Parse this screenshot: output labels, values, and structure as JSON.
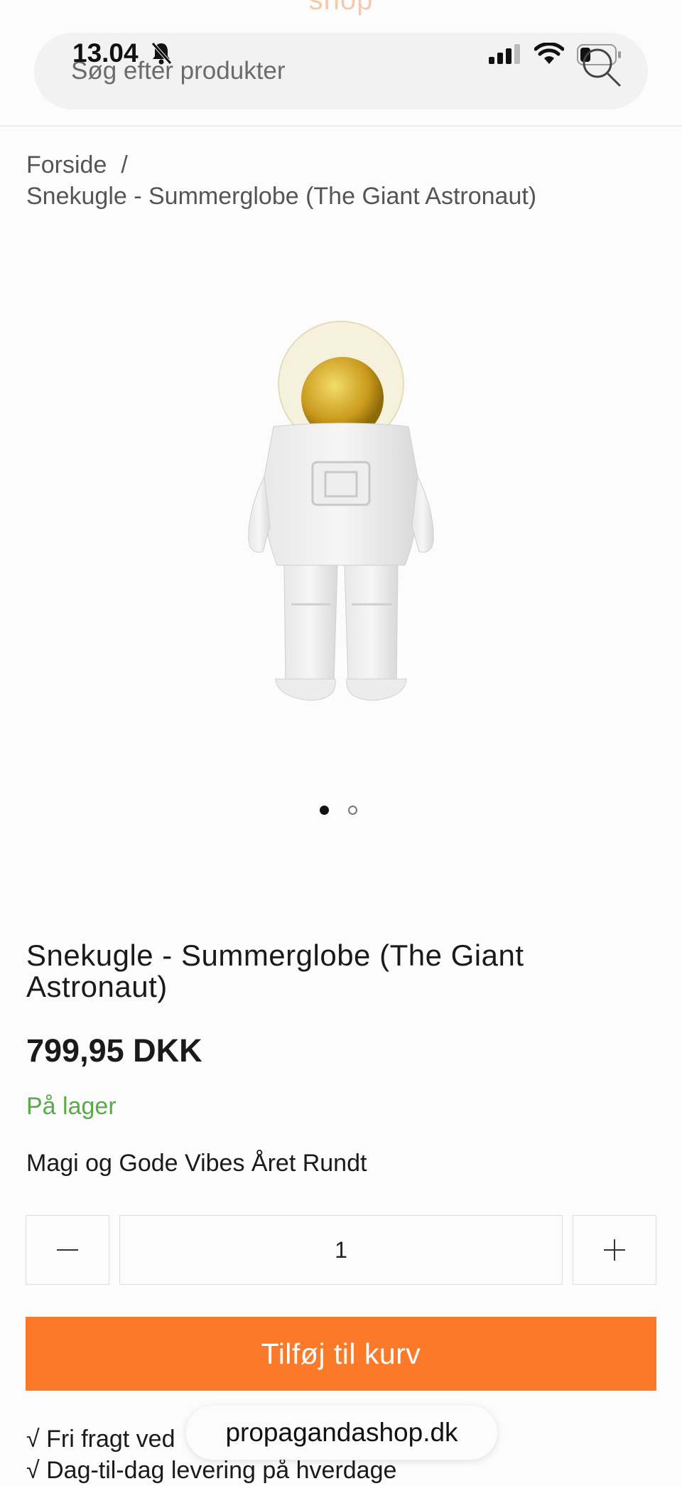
{
  "status_bar": {
    "time": "13.04",
    "icons": [
      "bell-slash-icon",
      "cellular-signal-icon",
      "wifi-icon",
      "battery-icon"
    ]
  },
  "header": {
    "logo_text": "shop",
    "search_placeholder": "Søg efter produkter"
  },
  "breadcrumb": {
    "home": "Forside",
    "separator": "/",
    "current": "Snekugle - Summerglobe (The Giant Astronaut)"
  },
  "gallery": {
    "image_count": 2,
    "active_index": 0
  },
  "product": {
    "title": "Snekugle - Summerglobe (The Giant Astronaut)",
    "price": "799,95  DKK",
    "stock_status": "På lager",
    "tagline": "Magi og Gode Vibes Året Rundt"
  },
  "quantity": {
    "minus": "−",
    "value": "1",
    "plus": "+"
  },
  "cart": {
    "add_label": "Tilføj til kurv"
  },
  "perks": [
    "√ Fri fragt ved",
    "√ Dag-til-dag levering på hverdage"
  ],
  "browser": {
    "url": "propagandashop.dk"
  },
  "colors": {
    "accent": "#fb7a2a",
    "stock_green": "#5aa94a"
  }
}
